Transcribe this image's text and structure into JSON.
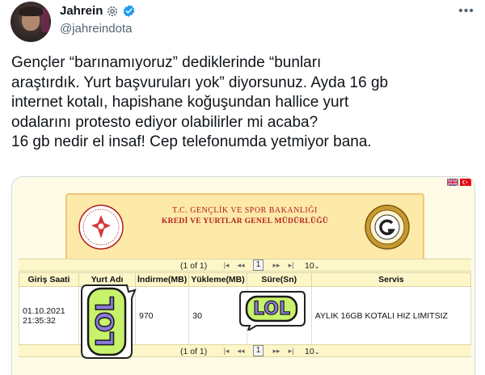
{
  "author": {
    "name": "Jahrein",
    "handle": "@jahreindota"
  },
  "tweet_lines": [
    "Gençler “barınamıyoruz” dediklerinde “bunları",
    "araştırdık. Yurt başvuruları yok” diyorsunuz. Ayda 16 gb",
    "internet kotalı, hapishane koğuşundan hallice yurt",
    "odalarını protesto ediyor olabilirler mi acaba?",
    "16 gb nedir el insaf! Cep telefonumda yetmiyor bana."
  ],
  "screenshot": {
    "banner_line1": "T.C. GENÇLİK VE SPOR BAKANLIĞI",
    "banner_line2": "KREDİ VE YURTLAR GENEL MÜDÜRLÜĞÜ",
    "pager": {
      "info": "(1 of 1)",
      "current_page": "1",
      "page_size": "10"
    },
    "columns": [
      "Giriş Saati",
      "Yurt Adı",
      "İndirme(MB)",
      "Yükleme(MB)",
      "Süre(Sn)",
      "Servis"
    ],
    "row": {
      "giris_saati": "01.10.2021 21:35:32",
      "yurt_adi": "",
      "indirme": "970",
      "yukleme": "30",
      "sure": "",
      "servis": "AYLIK 16GB KOTALI HIZ LIMITSIZ"
    },
    "stickers": [
      "LOL",
      "LOL"
    ]
  },
  "icons": [
    "gear-icon",
    "verified-badge-icon",
    "more-icon",
    "flag-uk-icon",
    "flag-tr-icon"
  ],
  "colors": {
    "verified": "#1d9bf0",
    "banner_text": "#b21e1e",
    "sticker_fill": "#c7f26b",
    "sticker_text": "#8b7bd8"
  }
}
